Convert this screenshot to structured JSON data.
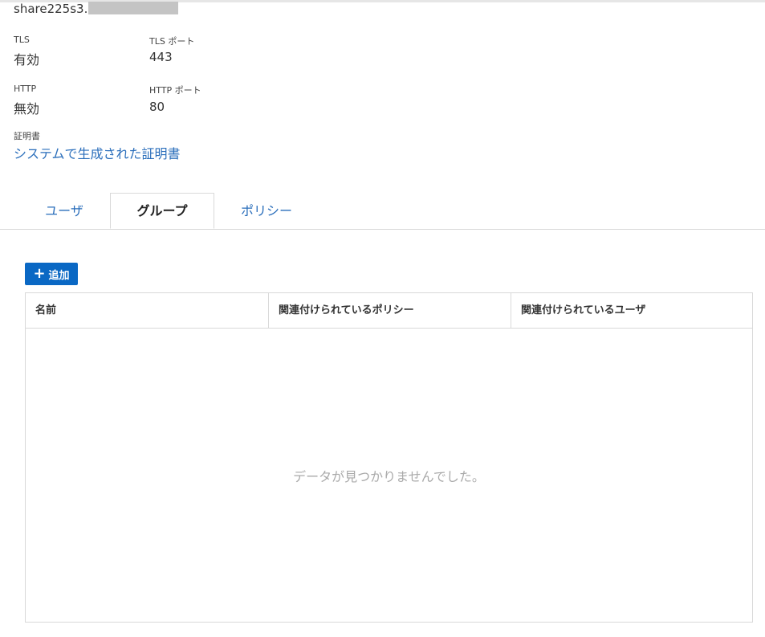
{
  "header": {
    "hostname_visible": "share225s3."
  },
  "settings": {
    "tls": {
      "label": "TLS",
      "value": "有効"
    },
    "tls_port": {
      "label": "TLS ポート",
      "value": "443"
    },
    "http": {
      "label": "HTTP",
      "value": "無効"
    },
    "http_port": {
      "label": "HTTP ポート",
      "value": "80"
    },
    "certificate": {
      "label": "証明書",
      "value": "システムで生成された証明書"
    }
  },
  "tabs": [
    {
      "label": "ユーザ",
      "active": false
    },
    {
      "label": "グループ",
      "active": true
    },
    {
      "label": "ポリシー",
      "active": false
    }
  ],
  "toolbar": {
    "add_label": "追加",
    "add_icon": "plus-icon"
  },
  "table": {
    "columns": [
      "名前",
      "関連付けられているポリシー",
      "関連付けられているユーザ"
    ],
    "rows": [],
    "empty_message": "データが見つかりませんでした。"
  },
  "colors": {
    "accent": "#0a68c4",
    "link": "#2a6ebb",
    "border": "#d9d9d9",
    "empty_text": "#aaaaaa"
  }
}
